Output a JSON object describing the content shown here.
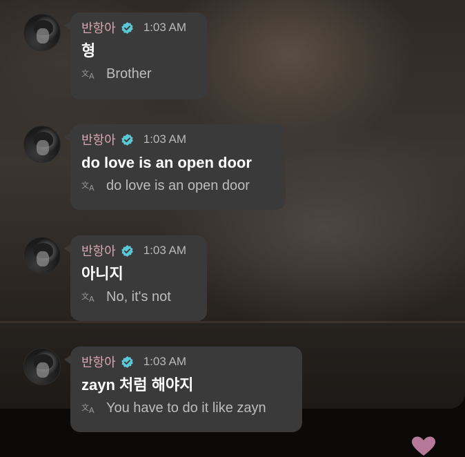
{
  "messages": [
    {
      "author": "반항아",
      "time": "1:03 AM",
      "text": "형",
      "translation": "Brother"
    },
    {
      "author": "반항아",
      "time": "1:03 AM",
      "text": "do love is an open door",
      "translation": "do love is an open door"
    },
    {
      "author": "반항아",
      "time": "1:03 AM",
      "text": "아니지",
      "translation": "No, it's not"
    },
    {
      "author": "반항아",
      "time": "1:03 AM",
      "text": "zayn 처럼 해야지",
      "translation": "You have to do it like zayn"
    }
  ],
  "colors": {
    "bubble": "#3a3a3a",
    "author": "#d9a7b3",
    "verified": "#5bc8d8",
    "text": "#ffffff",
    "translation": "#bdbdbd"
  },
  "icons": {
    "verified": "verified-badge-icon",
    "translate": "translate-icon",
    "reaction": "heart-icon"
  }
}
